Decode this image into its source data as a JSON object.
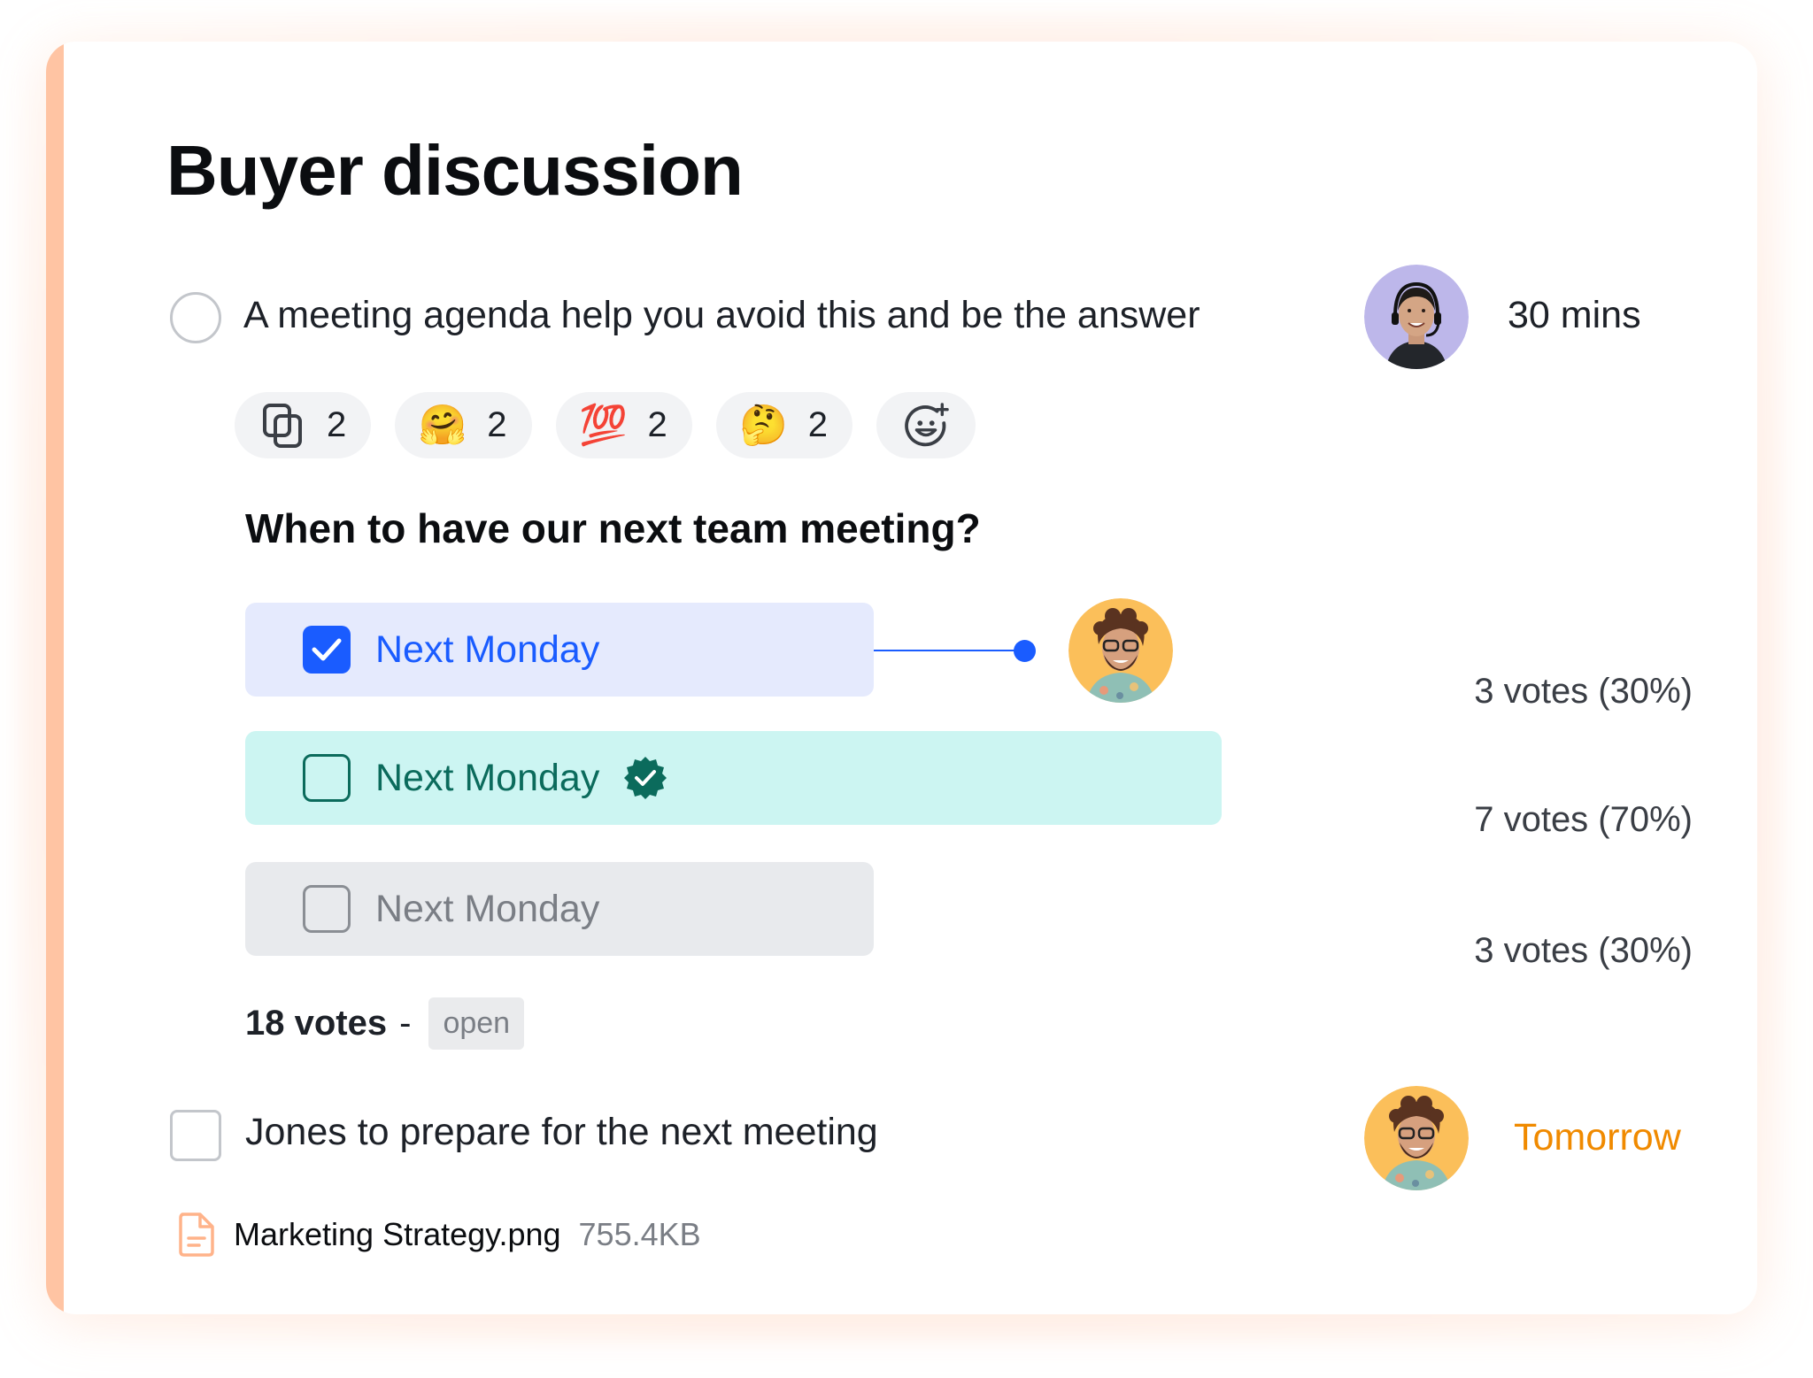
{
  "card": {
    "title": "Buyer discussion",
    "accent_color": "#FFC4A3"
  },
  "agenda_item_1": {
    "text": "A meeting agenda help you avoid this and be the answer",
    "checked": false,
    "assignee_avatar": "woman-with-headset",
    "duration": "30 mins",
    "reactions": [
      {
        "icon": "copy-icon",
        "glyph": "",
        "count": "2"
      },
      {
        "icon": "hugging-face-emoji",
        "glyph": "🤗",
        "count": "2"
      },
      {
        "icon": "hundred-points-emoji",
        "glyph": "💯",
        "count": "2"
      },
      {
        "icon": "thinking-face-emoji",
        "glyph": "🤔",
        "count": "2"
      }
    ],
    "add_reaction_icon": "add-emoji-icon"
  },
  "poll": {
    "question": "When to have our next team meeting?",
    "options": [
      {
        "label": "Next Monday",
        "checked": true,
        "votes": "3 votes (30%)",
        "share": 0.3,
        "color": "#1A5CFF",
        "bg": "#E5EAFD",
        "has_voter_avatar": true
      },
      {
        "label": "Next Monday",
        "checked": false,
        "votes": "7 votes (70%)",
        "share": 0.7,
        "color": "#0B6B5C",
        "bg": "#CCF5F2",
        "winner_badge": true
      },
      {
        "label": "Next Monday",
        "checked": false,
        "votes": "3 votes (30%)",
        "share": 0.3,
        "color": "#7A7E85",
        "bg": "#E8EAED"
      }
    ],
    "total_votes": "18 votes",
    "separator": "-",
    "status": "open"
  },
  "agenda_item_2": {
    "text": "Jones to prepare for the next meeting",
    "checked": false,
    "assignee_avatar": "curly-hair-man",
    "due": "Tomorrow",
    "due_color": "#F08A00"
  },
  "attachment": {
    "name": "Marketing Strategy.png",
    "size": "755.4KB",
    "icon": "file-icon"
  }
}
